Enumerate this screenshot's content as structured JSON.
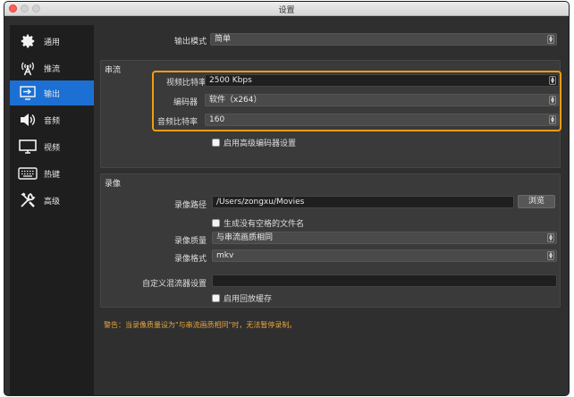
{
  "window": {
    "title": "设置"
  },
  "sidebar": {
    "items": [
      {
        "label": "通用",
        "icon": "gear-icon",
        "active": false
      },
      {
        "label": "推流",
        "icon": "broadcast-icon",
        "active": false
      },
      {
        "label": "输出",
        "icon": "output-icon",
        "active": true
      },
      {
        "label": "音频",
        "icon": "speaker-icon",
        "active": false
      },
      {
        "label": "视频",
        "icon": "monitor-icon",
        "active": false
      },
      {
        "label": "热键",
        "icon": "keyboard-icon",
        "active": false
      },
      {
        "label": "高级",
        "icon": "tools-icon",
        "active": false
      }
    ]
  },
  "output_mode": {
    "label": "输出模式",
    "value": "简单"
  },
  "streaming": {
    "title": "串流",
    "video_bitrate": {
      "label": "视频比特率",
      "value": "2500 Kbps"
    },
    "encoder": {
      "label": "编码器",
      "value": "软件（x264）"
    },
    "audio_bitrate": {
      "label": "音频比特率",
      "value": "160"
    },
    "advanced_encoder": {
      "label": "启用高级编码器设置"
    }
  },
  "recording": {
    "title": "录像",
    "path": {
      "label": "录像路径",
      "value": "/Users/zongxu/Movies",
      "browse": "浏览"
    },
    "no_space": {
      "label": "生成没有空格的文件名"
    },
    "quality": {
      "label": "录像质量",
      "value": "与串流画质相同"
    },
    "format": {
      "label": "录像格式",
      "value": "mkv"
    },
    "muxer": {
      "label": "自定义混流器设置",
      "value": ""
    },
    "replay_buffer": {
      "label": "启用回放缓存"
    }
  },
  "warning": "警告：当录像质量设为\"与串流画质相同\"时，无法暂停录制。",
  "colors": {
    "accent": "#1c6fd3",
    "highlight": "#f39c12",
    "warning": "#e8a53b"
  }
}
